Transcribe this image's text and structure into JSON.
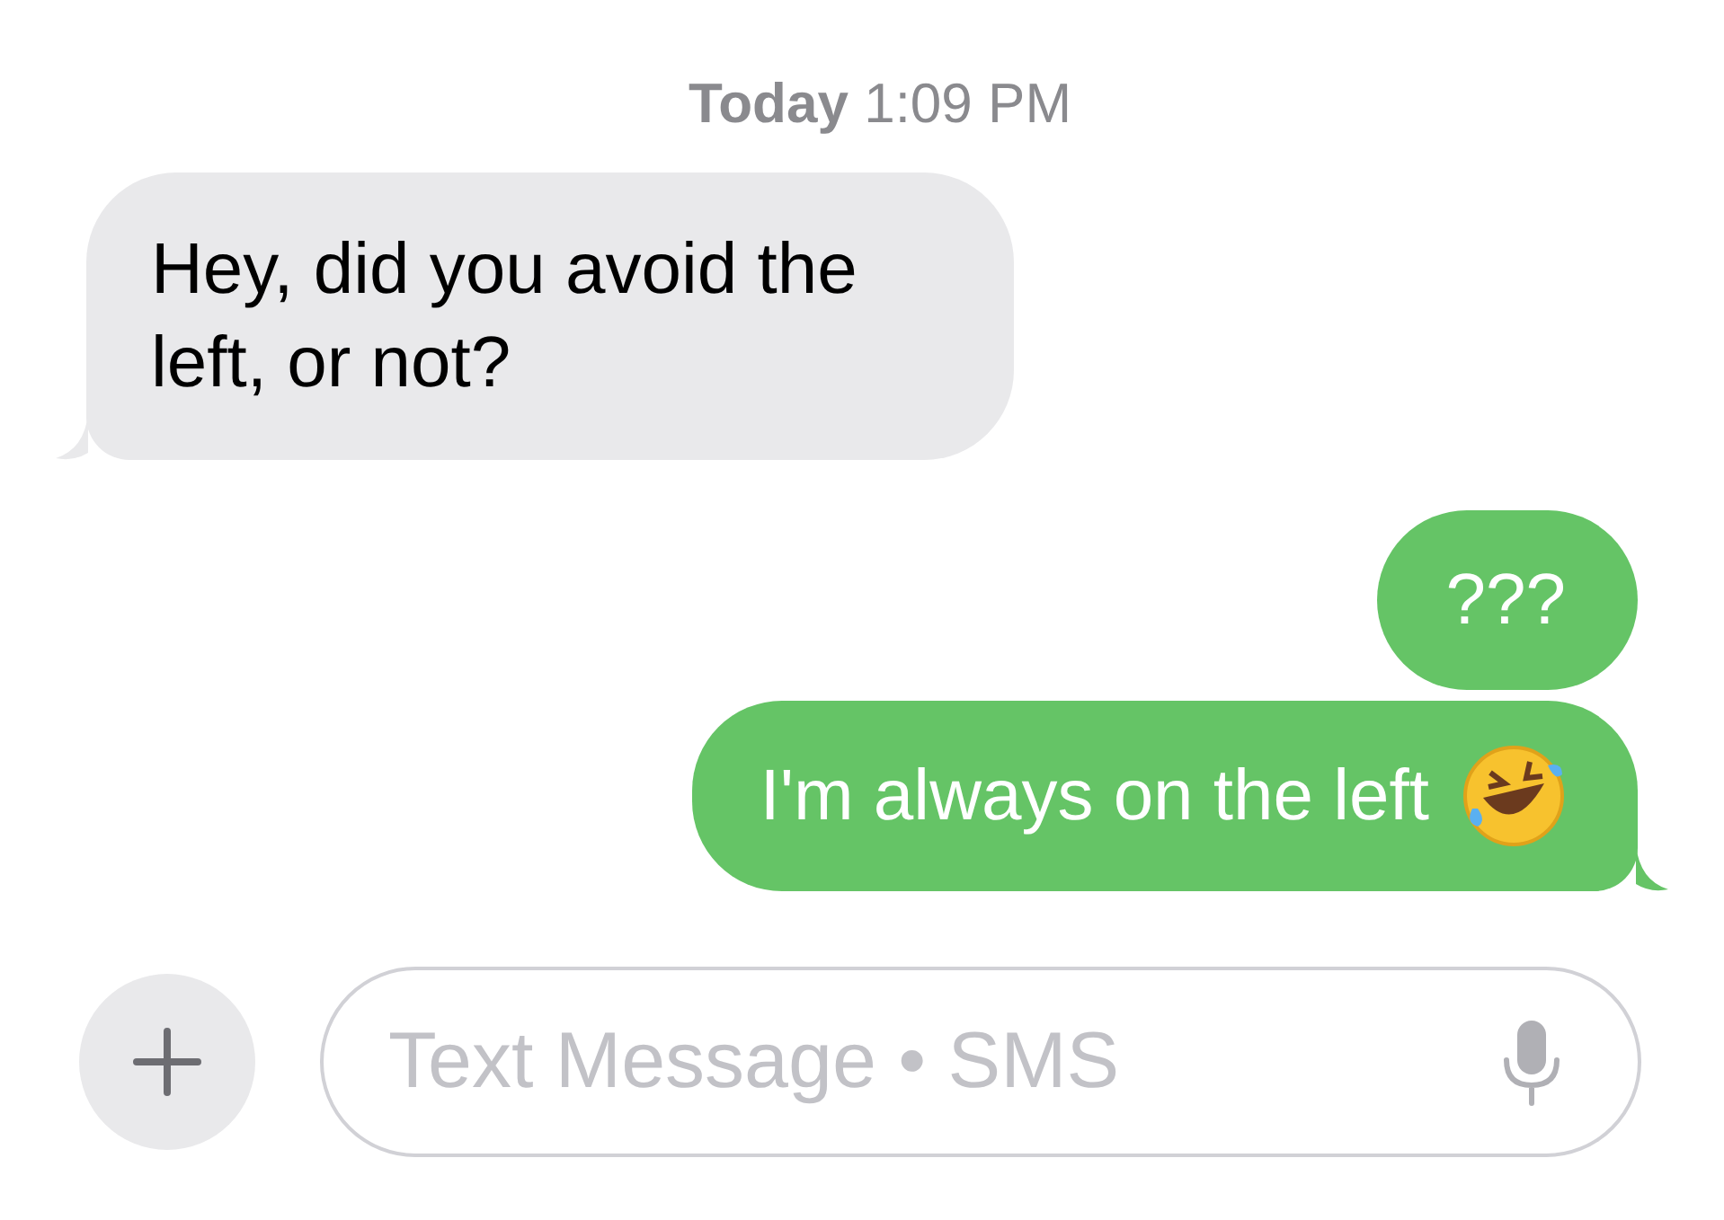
{
  "timestamp": "**Today** 1:09 PM",
  "messages": [
    {
      "kind": "incoming",
      "text": "Hey, did you avoid the left, or not?",
      "tail": true
    },
    {
      "kind": "outgoing",
      "text": "???",
      "tail": false
    },
    {
      "kind": "outgoing",
      "text": "I'm always on the left",
      "emoji": true,
      "tail": true
    }
  ],
  "composer": {
    "placeholder": "Text Message • SMS"
  }
}
